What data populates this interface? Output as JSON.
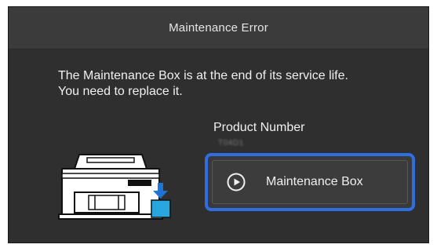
{
  "dialog": {
    "title": "Maintenance Error",
    "message_line1": "The Maintenance Box is at the end of its service life.",
    "message_line2": "You need to replace it.",
    "product_number_label": "Product Number",
    "product_number_value": "T04D1"
  },
  "action": {
    "button_label": "Maintenance Box",
    "icon": "play-circle-icon"
  },
  "colors": {
    "focus_border": "#2f6ee0",
    "background": "#2f2f2f",
    "ink_arrow": "#1e73d8",
    "box_cyan": "#2aa6df"
  }
}
